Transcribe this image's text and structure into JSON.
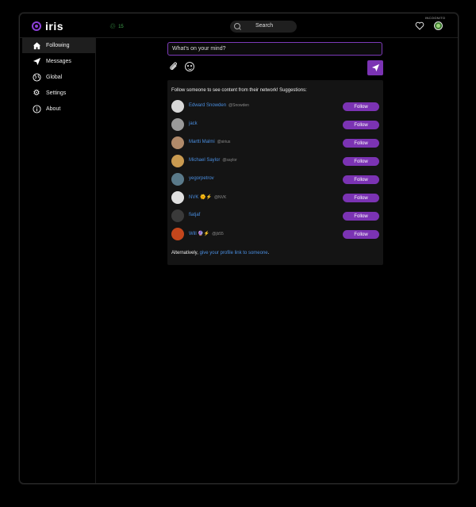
{
  "app": {
    "name": "iris"
  },
  "header": {
    "peers_count": "15",
    "search_placeholder": "Search",
    "incognito_label": "INCOGNITO"
  },
  "sidebar": {
    "items": [
      {
        "label": "Following",
        "icon": "home-icon",
        "active": true
      },
      {
        "label": "Messages",
        "icon": "paper-plane-icon",
        "active": false
      },
      {
        "label": "Global",
        "icon": "globe-icon",
        "active": false
      },
      {
        "label": "Settings",
        "icon": "gear-icon",
        "active": false
      },
      {
        "label": "About",
        "icon": "info-icon",
        "active": false
      }
    ]
  },
  "compose": {
    "placeholder": "What's on your mind?"
  },
  "suggestions": {
    "title": "Follow someone to see content from their network! Suggestions:",
    "follow_label": "Follow",
    "users": [
      {
        "name": "Edward Snowden",
        "handle": "@Snowden",
        "avatar_color": "#d8d8d8"
      },
      {
        "name": "jack",
        "handle": "",
        "avatar_color": "#9a9a9a"
      },
      {
        "name": "Martti Malmi",
        "handle": "@sirius",
        "avatar_color": "#b08a6a"
      },
      {
        "name": "Michael Saylor",
        "handle": "@saylor",
        "avatar_color": "#c99a50"
      },
      {
        "name": "yegorpetrov",
        "handle": "",
        "avatar_color": "#5a7a8a"
      },
      {
        "name": "NVK 🌞⚡",
        "handle": "@NVK",
        "avatar_color": "#e0e0e0"
      },
      {
        "name": "fiatjaf",
        "handle": "",
        "avatar_color": "#3a3a3a"
      },
      {
        "name": "Will 🔮⚡",
        "handle": "@jb55",
        "avatar_color": "#c4461c"
      }
    ],
    "alt_prefix": "Alternatively, ",
    "alt_link": "give your profile link to someone",
    "alt_suffix": "."
  },
  "colors": {
    "accent": "#7b33b3",
    "link": "#4a8ee0",
    "peers": "#3fa34d"
  }
}
